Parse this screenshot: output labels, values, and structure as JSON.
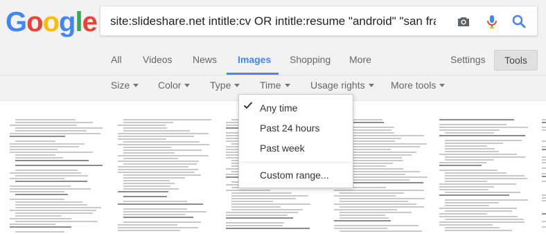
{
  "logo": {
    "letters": [
      "G",
      "o",
      "o",
      "g",
      "l",
      "e"
    ]
  },
  "search": {
    "query": "site:slideshare.net intitle:cv OR intitle:resume \"android\" \"san francis"
  },
  "icons": {
    "camera": "camera-icon",
    "mic": "mic-icon",
    "search": "search-icon",
    "check": "check-icon"
  },
  "tabs": [
    {
      "label": "All"
    },
    {
      "label": "Videos"
    },
    {
      "label": "News"
    },
    {
      "label": "Images",
      "active": true
    },
    {
      "label": "Shopping"
    },
    {
      "label": "More"
    }
  ],
  "settings_label": "Settings",
  "tools_label": "Tools",
  "filters": [
    {
      "label": "Size"
    },
    {
      "label": "Color"
    },
    {
      "label": "Type"
    },
    {
      "label": "Time"
    },
    {
      "label": "Usage rights"
    },
    {
      "label": "More tools"
    }
  ],
  "time_menu": {
    "selected": "Any time",
    "items": [
      {
        "label": "Any time",
        "checked": true
      },
      {
        "label": "Past 24 hours"
      },
      {
        "label": "Past week"
      },
      {
        "label": "Custom range..."
      }
    ]
  },
  "colors": {
    "blue": "#4285f4",
    "red": "#ea4335",
    "yellow": "#fbbc05",
    "green": "#34a853"
  }
}
